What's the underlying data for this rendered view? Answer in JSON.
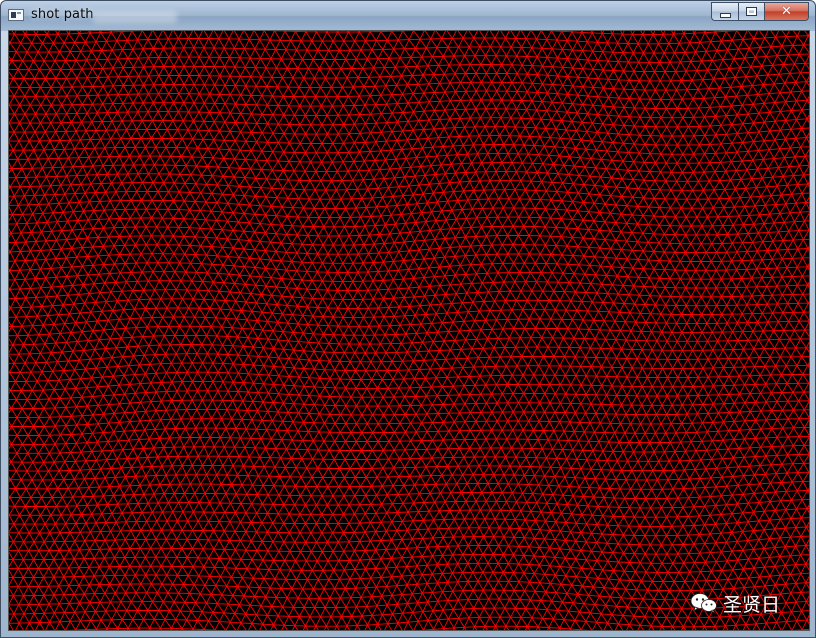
{
  "window": {
    "title": "shot path",
    "buttons": {
      "minimize": "minimize",
      "maximize": "maximize",
      "close": "✕"
    }
  },
  "canvas": {
    "background": "#000000",
    "mesh_color": "#ff0000",
    "content": "triangle-mesh"
  },
  "watermark": {
    "icon": "wechat-icon",
    "text": "圣贤日"
  }
}
